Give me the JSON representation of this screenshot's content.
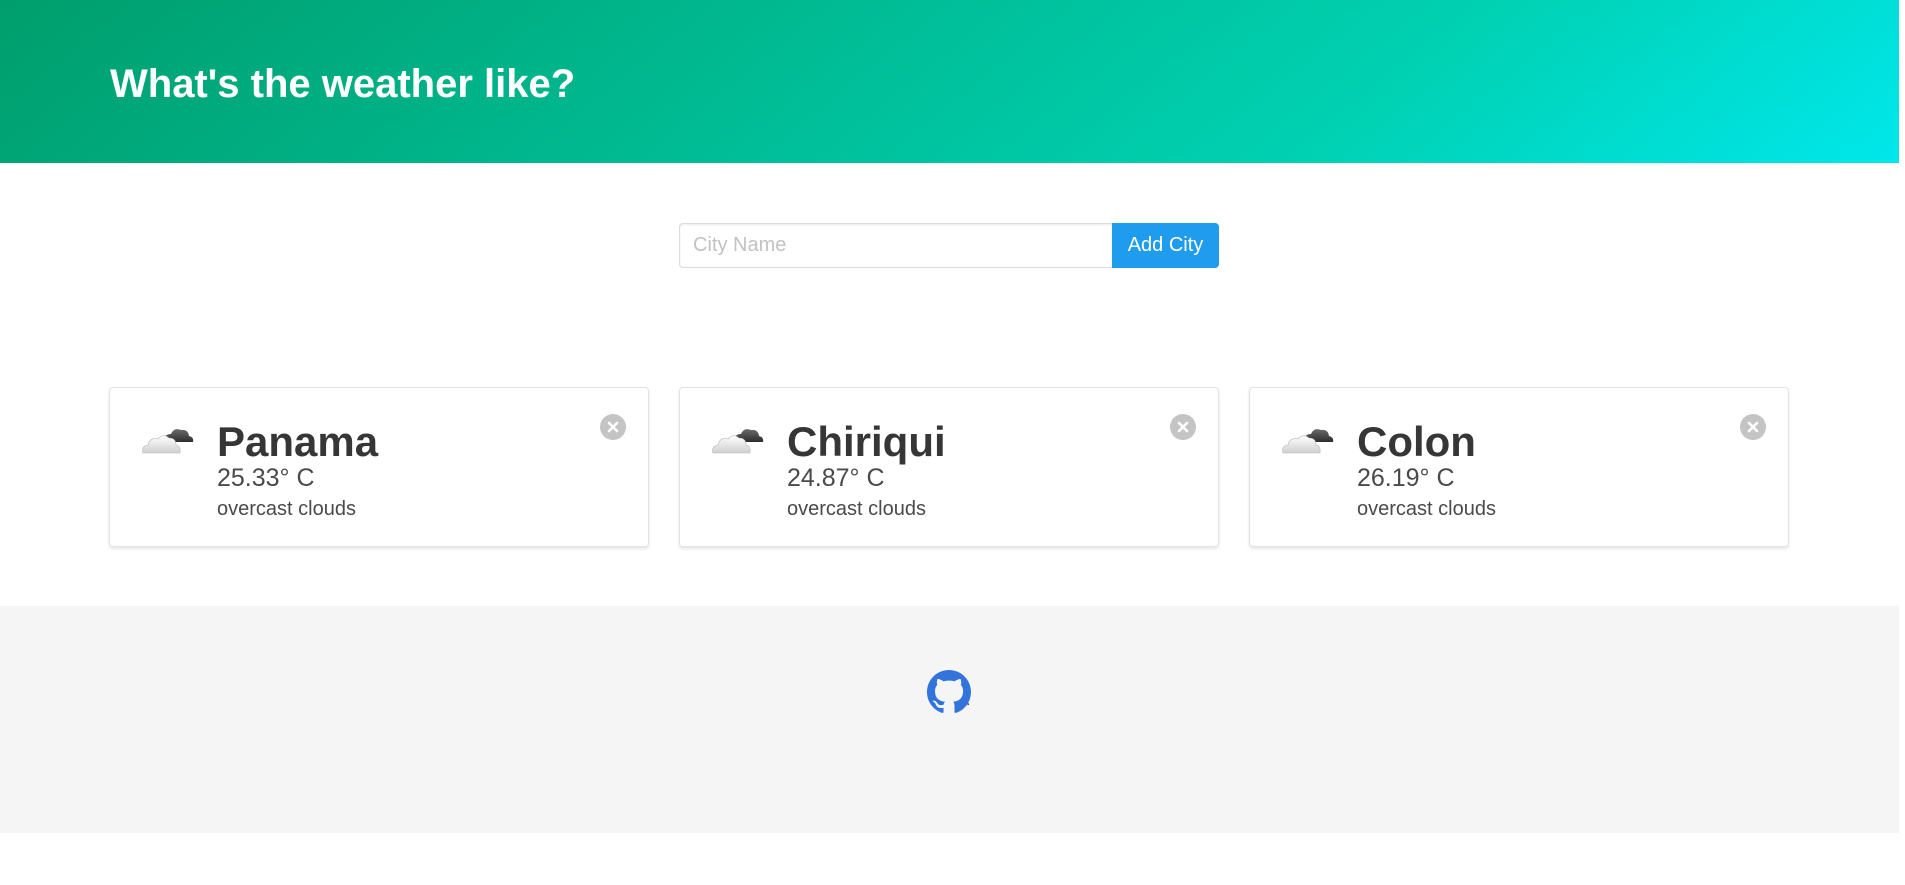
{
  "header": {
    "title": "What's the weather like?"
  },
  "search": {
    "placeholder": "City Name",
    "value": "",
    "button_label": "Add City"
  },
  "cities": [
    {
      "name": "Panama",
      "temperature": "25.33° C",
      "description": "overcast clouds",
      "icon": "overcast-clouds-icon"
    },
    {
      "name": "Chiriqui",
      "temperature": "24.87° C",
      "description": "overcast clouds",
      "icon": "overcast-clouds-icon"
    },
    {
      "name": "Colon",
      "temperature": "26.19° C",
      "description": "overcast clouds",
      "icon": "overcast-clouds-icon"
    }
  ],
  "footer": {
    "icon": "github-icon",
    "trailing_text": "."
  },
  "colors": {
    "hero_gradient_start": "#009e6c",
    "hero_gradient_mid": "#00d1b2",
    "hero_gradient_end": "#00e7eb",
    "button": "#209cee",
    "github": "#3273dc",
    "footer_bg": "#f5f5f5"
  }
}
